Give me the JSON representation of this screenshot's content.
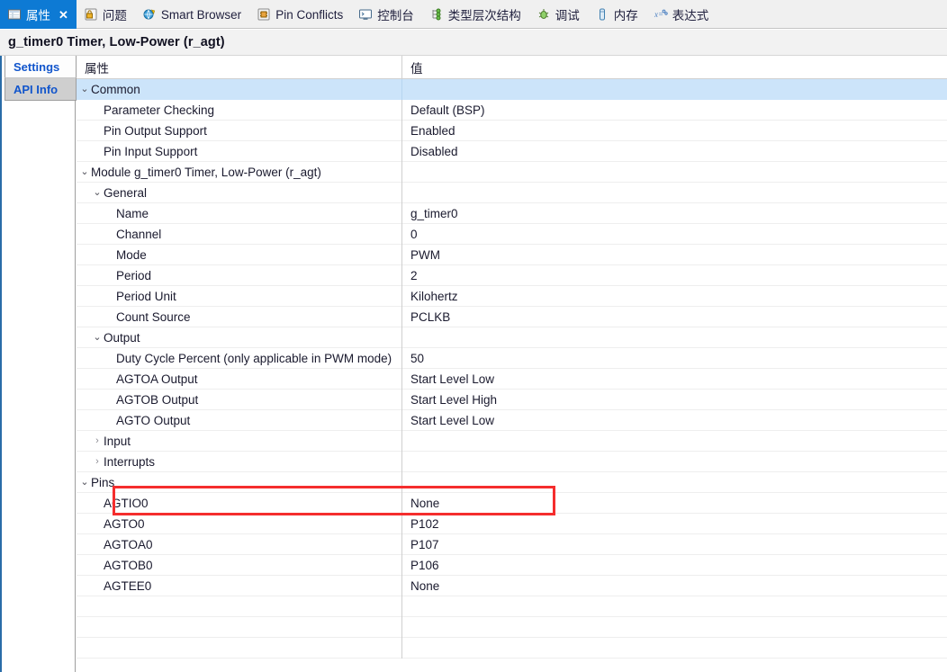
{
  "window": {
    "title": "g_timer0 Timer, Low-Power (r_agt)"
  },
  "colors": {
    "active_tab_bg": "#0d7ad4",
    "row_highlight": "#cce4fa",
    "annotation_red": "#f52d2d",
    "link_blue": "#1155cc"
  },
  "tabs": [
    {
      "label": "属性",
      "icon": "properties-icon",
      "active": true,
      "closable": true
    },
    {
      "label": "问题",
      "icon": "problems-icon",
      "active": false,
      "closable": false
    },
    {
      "label": "Smart Browser",
      "icon": "smart-browser-icon",
      "active": false,
      "closable": false
    },
    {
      "label": "Pin Conflicts",
      "icon": "pin-conflicts-icon",
      "active": false,
      "closable": false
    },
    {
      "label": "控制台",
      "icon": "console-icon",
      "active": false,
      "closable": false
    },
    {
      "label": "类型层次结构",
      "icon": "type-hierarchy-icon",
      "active": false,
      "closable": false
    },
    {
      "label": "调试",
      "icon": "debug-icon",
      "active": false,
      "closable": false
    },
    {
      "label": "内存",
      "icon": "memory-icon",
      "active": false,
      "closable": false
    },
    {
      "label": "表达式",
      "icon": "expressions-icon",
      "active": false,
      "closable": false
    }
  ],
  "tab_close_glyph": "✕",
  "side_tabs": [
    {
      "label": "Settings",
      "active": true
    },
    {
      "label": "API Info",
      "active": false
    }
  ],
  "table": {
    "headers": {
      "property": "属性",
      "value": "值"
    },
    "twisty_open": "⌄",
    "twisty_closed": "›",
    "rows": [
      {
        "indent": 0,
        "twisty": "open",
        "property": "Common",
        "value": "",
        "highlight": true
      },
      {
        "indent": 1,
        "twisty": "none",
        "property": "Parameter Checking",
        "value": "Default (BSP)",
        "highlight": false
      },
      {
        "indent": 1,
        "twisty": "none",
        "property": "Pin Output Support",
        "value": "Enabled",
        "highlight": false
      },
      {
        "indent": 1,
        "twisty": "none",
        "property": "Pin Input Support",
        "value": "Disabled",
        "highlight": false
      },
      {
        "indent": 0,
        "twisty": "open",
        "property": "Module g_timer0 Timer, Low-Power (r_agt)",
        "value": "",
        "highlight": false
      },
      {
        "indent": 1,
        "twisty": "open",
        "property": "General",
        "value": "",
        "highlight": false
      },
      {
        "indent": 2,
        "twisty": "none",
        "property": "Name",
        "value": "g_timer0",
        "highlight": false
      },
      {
        "indent": 2,
        "twisty": "none",
        "property": "Channel",
        "value": "0",
        "highlight": false
      },
      {
        "indent": 2,
        "twisty": "none",
        "property": "Mode",
        "value": "PWM",
        "highlight": false
      },
      {
        "indent": 2,
        "twisty": "none",
        "property": "Period",
        "value": "2",
        "highlight": false
      },
      {
        "indent": 2,
        "twisty": "none",
        "property": "Period Unit",
        "value": "Kilohertz",
        "highlight": false
      },
      {
        "indent": 2,
        "twisty": "none",
        "property": "Count Source",
        "value": "PCLKB",
        "highlight": false
      },
      {
        "indent": 1,
        "twisty": "open",
        "property": "Output",
        "value": "",
        "highlight": false
      },
      {
        "indent": 2,
        "twisty": "none",
        "property": "Duty Cycle Percent (only applicable in PWM mode)",
        "value": "50",
        "highlight": false
      },
      {
        "indent": 2,
        "twisty": "none",
        "property": "AGTOA Output",
        "value": "Start Level Low",
        "highlight": false
      },
      {
        "indent": 2,
        "twisty": "none",
        "property": "AGTOB Output",
        "value": "Start Level High",
        "highlight": false
      },
      {
        "indent": 2,
        "twisty": "none",
        "property": "AGTO Output",
        "value": "Start Level Low",
        "highlight": false
      },
      {
        "indent": 1,
        "twisty": "closed",
        "property": "Input",
        "value": "",
        "highlight": false
      },
      {
        "indent": 1,
        "twisty": "closed",
        "property": "Interrupts",
        "value": "",
        "highlight": false
      },
      {
        "indent": 0,
        "twisty": "open",
        "property": "Pins",
        "value": "",
        "highlight": false
      },
      {
        "indent": 1,
        "twisty": "none",
        "property": "AGTIO0",
        "value": "None",
        "highlight": false
      },
      {
        "indent": 1,
        "twisty": "none",
        "property": "AGTO0",
        "value": "P102",
        "highlight": false
      },
      {
        "indent": 1,
        "twisty": "none",
        "property": "AGTOA0",
        "value": "P107",
        "highlight": false
      },
      {
        "indent": 1,
        "twisty": "none",
        "property": "AGTOB0",
        "value": "P106",
        "highlight": false
      },
      {
        "indent": 1,
        "twisty": "none",
        "property": "AGTEE0",
        "value": "None",
        "highlight": false
      },
      {
        "indent": 1,
        "twisty": "none",
        "property": "",
        "value": "",
        "highlight": false
      },
      {
        "indent": 1,
        "twisty": "none",
        "property": "",
        "value": "",
        "highlight": false
      },
      {
        "indent": 1,
        "twisty": "none",
        "property": "",
        "value": "",
        "highlight": false
      }
    ]
  },
  "annotation": {
    "name": "agto-output-highlight",
    "target_row_property": "AGTO Output",
    "target_row_value": "Start Level Low"
  }
}
